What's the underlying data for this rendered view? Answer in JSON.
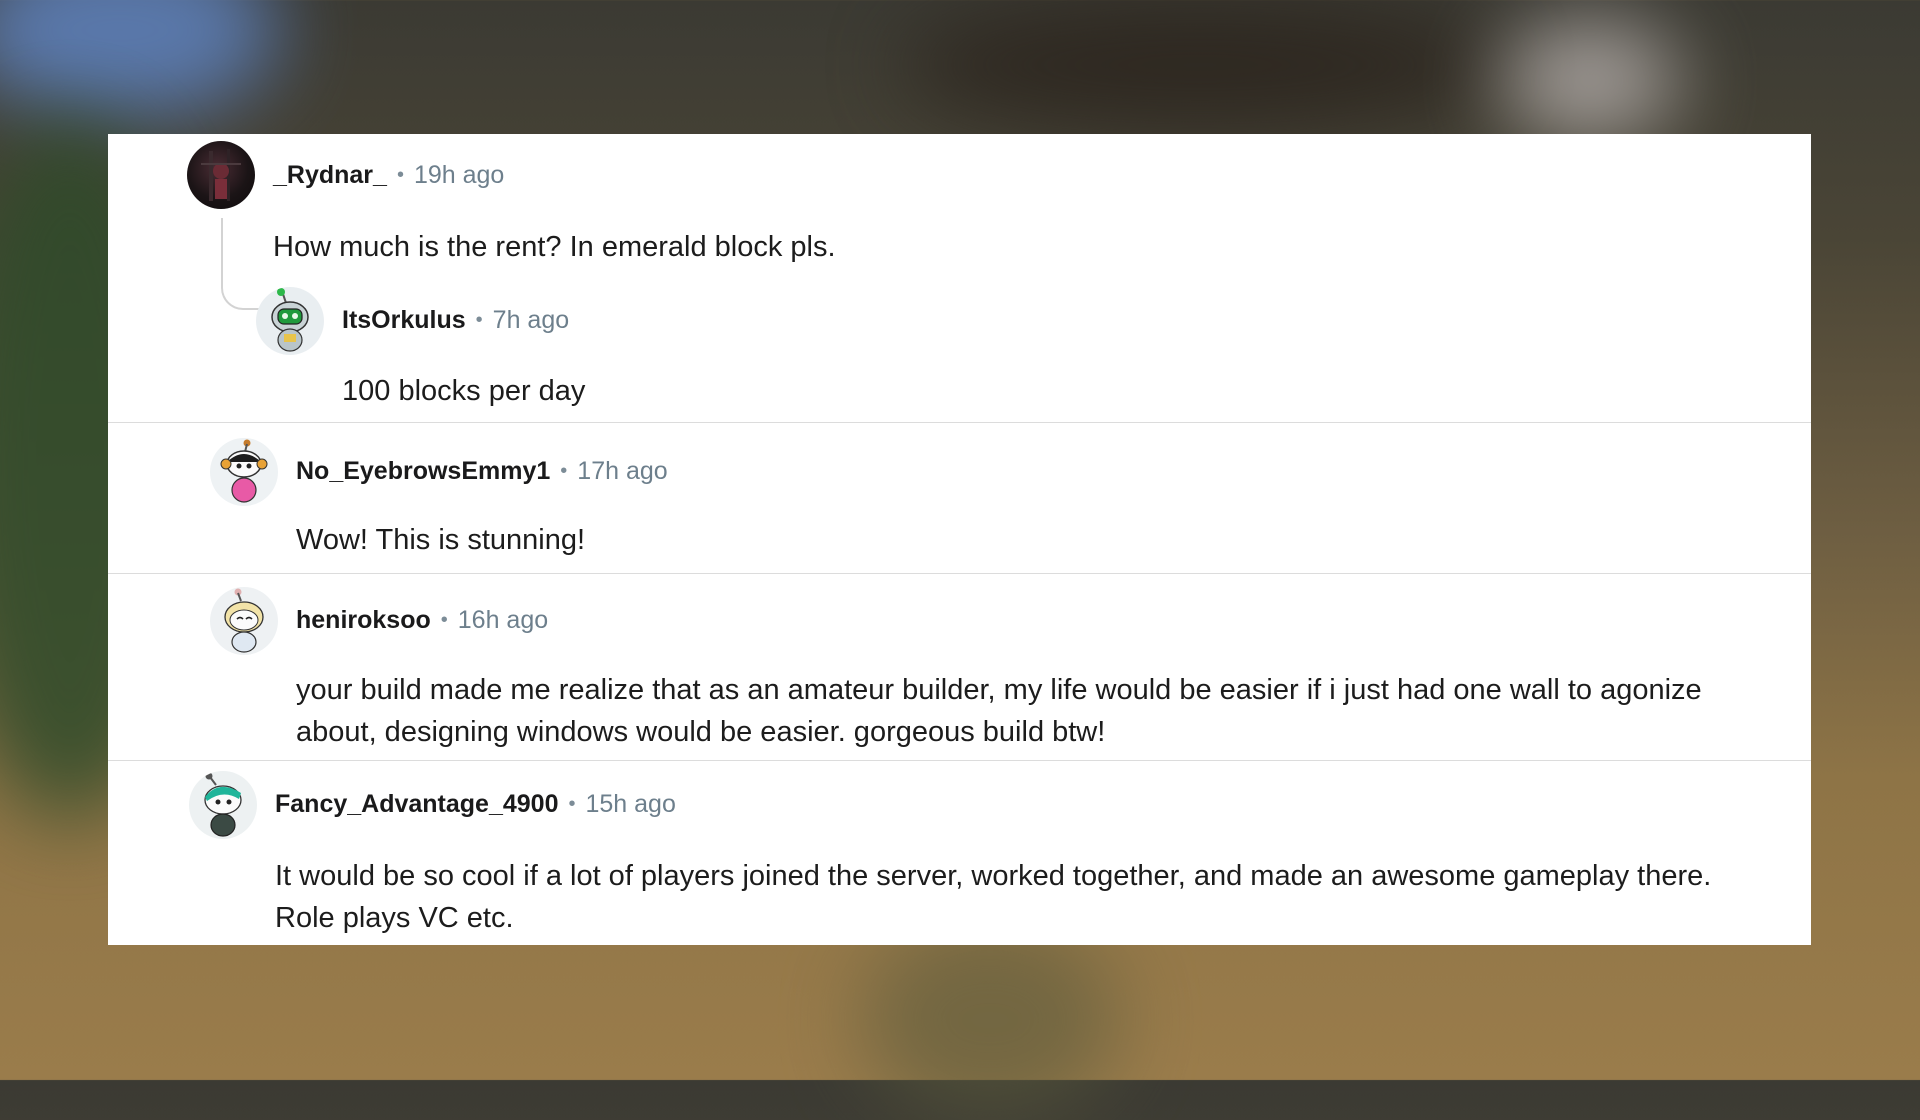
{
  "comments": [
    {
      "username": "_Rydnar_",
      "separator": "•",
      "time": "19h ago",
      "text": "How much is the rent? In emerald block pls.",
      "avatar_icon": "dark-photo-avatar-icon"
    },
    {
      "username": "ItsOrkulus",
      "separator": "•",
      "time": "7h ago",
      "text": "100 blocks per day",
      "avatar_icon": "green-robot-snoo-avatar-icon"
    },
    {
      "username": "No_EyebrowsEmmy1",
      "separator": "•",
      "time": "17h ago",
      "text": "Wow! This is stunning!",
      "avatar_icon": "headphones-snoo-avatar-icon"
    },
    {
      "username": "heniroksoo",
      "separator": "•",
      "time": "16h ago",
      "text": "your build made me realize that as an amateur builder, my life would be easier if i just had one wall to agonize about, designing windows would be easier. gorgeous build btw!",
      "avatar_icon": "blonde-snoo-avatar-icon"
    },
    {
      "username": "Fancy_Advantage_4900",
      "separator": "•",
      "time": "15h ago",
      "text": "It would be so cool if a lot of players joined the server, worked together, and made an awesome gameplay there. Role plays VC etc.",
      "avatar_icon": "teal-hair-snoo-avatar-icon"
    }
  ],
  "colors": {
    "panel_bg": "#ffffff",
    "username": "#1a1a1b",
    "meta": "#6d7f8c",
    "body": "#1c1c1c",
    "divider": "#dcdcdc"
  }
}
